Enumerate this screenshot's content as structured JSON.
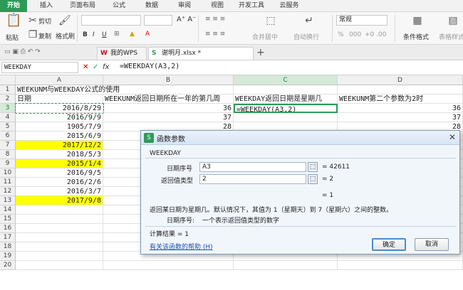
{
  "ribbon_tabs": [
    "开始",
    "插入",
    "页面布局",
    "公式",
    "数据",
    "审阅",
    "视图",
    "开发工具",
    "云服务"
  ],
  "ribbon": {
    "cut": "剪切",
    "paste": "粘贴",
    "copy": "复制",
    "format_painter": "格式刷",
    "merge_center": "合并居中",
    "auto_wrap": "自动换行",
    "number_format": "常规",
    "percent": "%",
    "thousands": "000",
    "conditional_format": "条件格式",
    "table_style": "表格样式"
  },
  "doc_tabs": [
    {
      "label": "我的WPS"
    },
    {
      "label": "谢明月.xlsx *"
    }
  ],
  "formula_bar": {
    "name_box": "WEEKDAY",
    "cancel": "✕",
    "confirm": "✓",
    "fx": "fx",
    "formula": "=WEEKDAY(A3,2)"
  },
  "columns": [
    "A",
    "B",
    "C",
    "D"
  ],
  "rows": [
    {
      "num": "1",
      "a": "WEEKUNM与WEEKDAY公式的使用",
      "b": "",
      "c": "",
      "d": "",
      "yellow": false
    },
    {
      "num": "2",
      "a": "日期",
      "b": "WEEKUNM返回日期所在一年的第几周",
      "c": "WEEKDAY返回日期是星期几",
      "d": "WEEKUNM第二个参数为2时",
      "yellow": false
    },
    {
      "num": "3",
      "a": "2016/8/29",
      "b": "36",
      "c": "=WEEKDAY(A3,2)",
      "d": "36",
      "yellow": false
    },
    {
      "num": "4",
      "a": "2016/9/9",
      "b": "37",
      "c": "",
      "d": "37",
      "yellow": false
    },
    {
      "num": "5",
      "a": "1905/7/9",
      "b": "28",
      "c": "",
      "d": "28",
      "yellow": false
    },
    {
      "num": "6",
      "a": "2015/6/9",
      "b": "",
      "c": "",
      "d": "",
      "yellow": false
    },
    {
      "num": "7",
      "a": "2017/12/2",
      "b": "",
      "c": "",
      "d": "",
      "yellow": true
    },
    {
      "num": "8",
      "a": "2018/5/3",
      "b": "",
      "c": "",
      "d": "",
      "yellow": false
    },
    {
      "num": "9",
      "a": "2015/1/4",
      "b": "",
      "c": "",
      "d": "",
      "yellow": true
    },
    {
      "num": "10",
      "a": "2016/9/5",
      "b": "",
      "c": "",
      "d": "",
      "yellow": false
    },
    {
      "num": "11",
      "a": "2016/2/6",
      "b": "",
      "c": "",
      "d": "",
      "yellow": false
    },
    {
      "num": "12",
      "a": "2016/3/7",
      "b": "",
      "c": "",
      "d": "",
      "yellow": false
    },
    {
      "num": "13",
      "a": "2017/9/8",
      "b": "",
      "c": "",
      "d": "",
      "yellow": true
    },
    {
      "num": "14",
      "a": "",
      "b": "",
      "c": "",
      "d": "",
      "yellow": false
    },
    {
      "num": "15",
      "a": "",
      "b": "",
      "c": "",
      "d": "",
      "yellow": false
    },
    {
      "num": "16",
      "a": "",
      "b": "",
      "c": "",
      "d": "",
      "yellow": false
    },
    {
      "num": "17",
      "a": "",
      "b": "",
      "c": "",
      "d": "",
      "yellow": false
    },
    {
      "num": "18",
      "a": "",
      "b": "",
      "c": "",
      "d": "",
      "yellow": false
    },
    {
      "num": "19",
      "a": "",
      "b": "",
      "c": "",
      "d": "",
      "yellow": false
    },
    {
      "num": "20",
      "a": "",
      "b": "",
      "c": "",
      "d": "",
      "yellow": false
    }
  ],
  "dialog": {
    "title": "函数参数",
    "close": "✕",
    "function_name": "WEEKDAY",
    "arg1_label": "日期序号",
    "arg1_value": "A3",
    "arg1_result": "= 42611",
    "arg2_label": "返回值类型",
    "arg2_value": "2",
    "arg2_result": "= 2",
    "result_preview": "= 1",
    "description": "返回某日期为星期几。默认情况下，其值为 1（星期天）到 7（星期六）之间的整数。",
    "arg_help_label": "日期序号:",
    "arg_help_text": "一个表示返回值类型的数字",
    "calc_result": "计算结果 = 1",
    "help_link": "有关该函数的帮助 (H)",
    "ok": "确定",
    "cancel": "取消"
  },
  "colors": {
    "accent": "#2e9a57",
    "highlight": "#ffff00"
  }
}
